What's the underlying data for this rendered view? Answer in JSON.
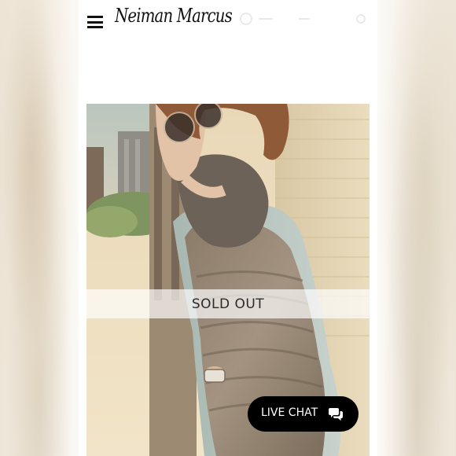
{
  "header": {
    "menu_icon": "hamburger-menu-icon",
    "logo_text": "Neiman Marcus"
  },
  "product": {
    "image_alt_icon": "product-photo",
    "status_label": "SOLD OUT"
  },
  "live_chat": {
    "label": "LIVE CHAT",
    "icon": "chat-bubbles-icon",
    "background": "#000000"
  }
}
